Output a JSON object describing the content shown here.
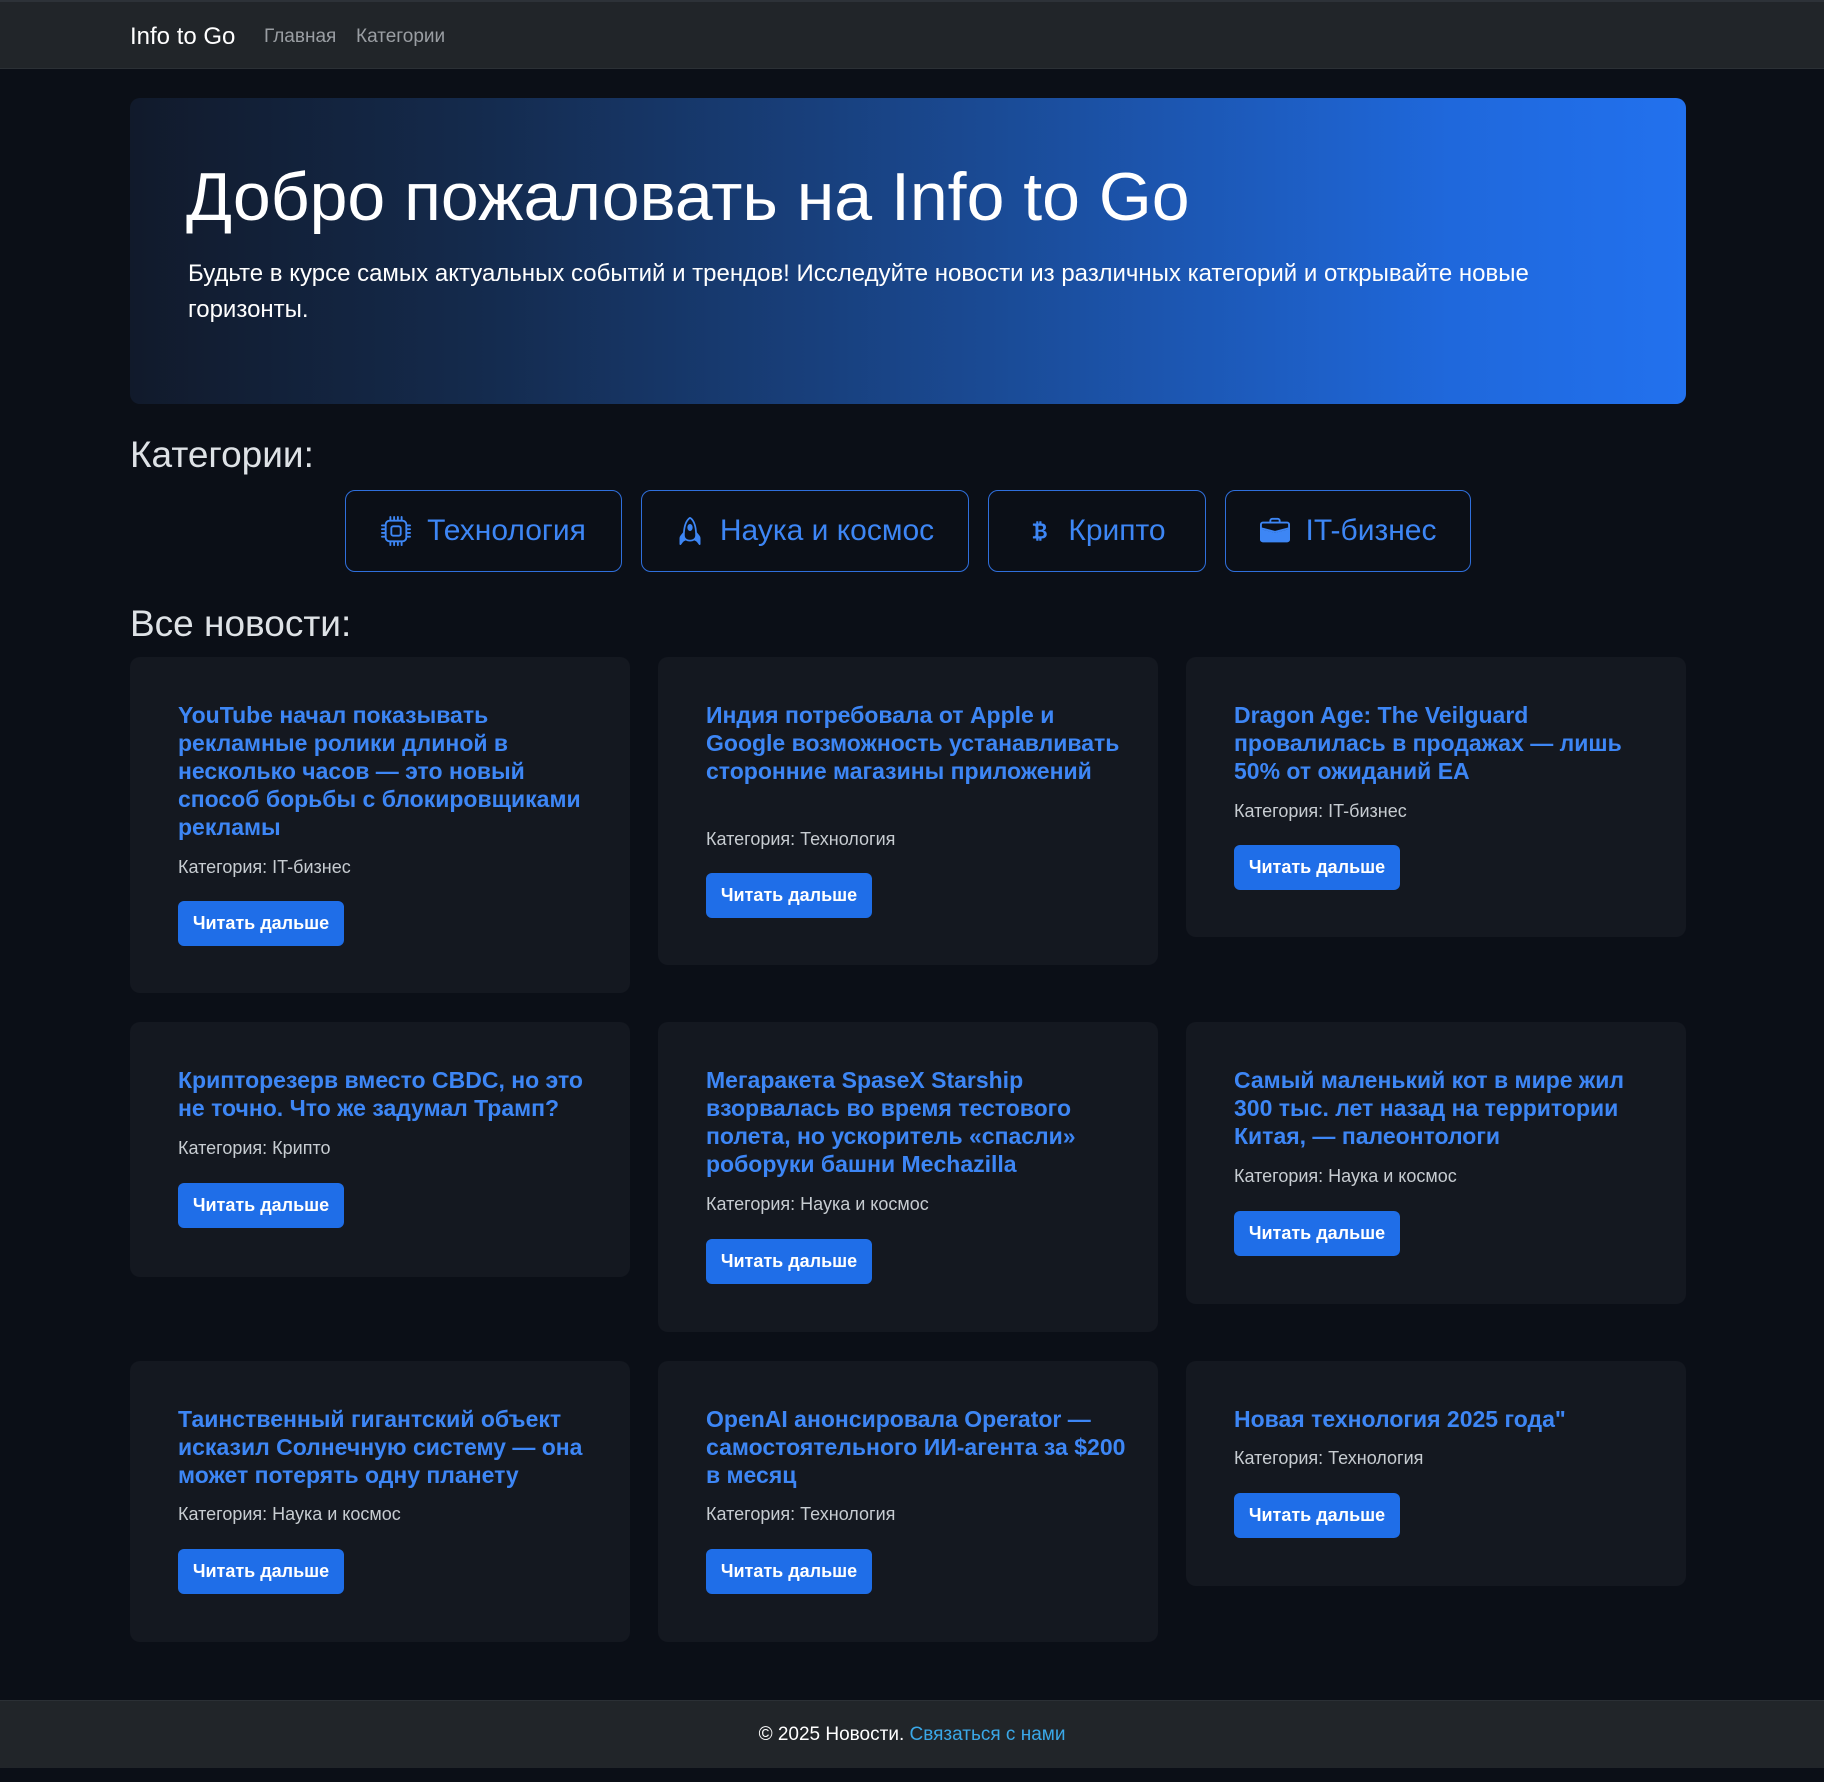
{
  "navbar": {
    "brand": "Info to Go",
    "links": [
      {
        "label": "Главная"
      },
      {
        "label": "Категории"
      }
    ]
  },
  "hero": {
    "title": "Добро пожаловать на Info to Go",
    "lead": "Будьте в курсе самых актуальных событий и трендов! Исследуйте новости из различных категорий и открывайте новые горизонты."
  },
  "categories_heading": "Категории:",
  "categories": [
    {
      "label": "Технология",
      "icon": "cpu-icon"
    },
    {
      "label": "Наука и космос",
      "icon": "rocket-icon"
    },
    {
      "label": "Крипто",
      "icon": "bitcoin-icon"
    },
    {
      "label": "IT-бизнес",
      "icon": "briefcase-icon"
    }
  ],
  "news_heading": "Все новости:",
  "category_label": "Категория:",
  "read_more_label": "Читать дальше",
  "news": [
    {
      "title": "YouTube начал показывать рекламные ролики длиной в несколько часов — это новый способ борьбы с блокировщиками рекламы",
      "category": "IT-бизнес"
    },
    {
      "title": "Индия потребовала от Apple и Google возможность устанавливать сторонние магазины приложений",
      "category": "Технология"
    },
    {
      "title": "Dragon Age: The Veilguard провалилась в продажах — лишь 50% от ожиданий EA",
      "category": "IT-бизнес"
    },
    {
      "title": "Крипторезерв вместо CBDC, но это не точно. Что же задумал Трамп?",
      "category": "Крипто"
    },
    {
      "title": "Мегаракета SpaseX Starship взорвалась во время тестового полета, но ускоритель «спасли» роборуки башни Mechazilla",
      "category": "Наука и космос"
    },
    {
      "title": "Самый маленький кот в мире жил 300 тыс. лет назад на территории Китая, — палеонтологи",
      "category": "Наука и космос"
    },
    {
      "title": "Таинственный гигантский объект исказил Солнечную систему — она может потерять одну планету",
      "category": "Наука и космос"
    },
    {
      "title": "OpenAI анонсировала Operator — самостоятельного ИИ-агента за $200 в месяц",
      "category": "Технология"
    },
    {
      "title": "Новая технология 2025 года\"",
      "category": "Технология"
    }
  ],
  "footer": {
    "text": "© 2025 Новости. ",
    "link": "Связаться с нами"
  },
  "colors": {
    "accent": "#1f6ee8",
    "link_blue": "#3d86f5",
    "background": "#0b0f17",
    "card": "#141820",
    "navbar": "#212529"
  }
}
